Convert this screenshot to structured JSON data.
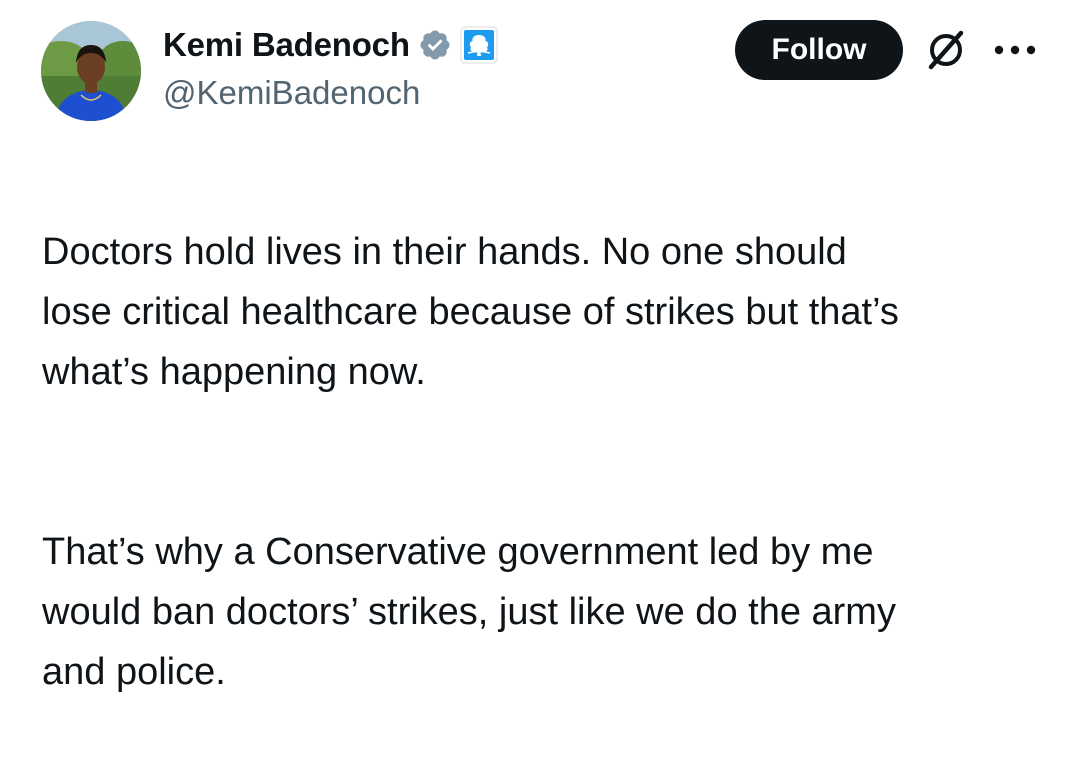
{
  "author": {
    "display_name": "Kemi Badenoch",
    "handle": "@KemiBadenoch",
    "verified_icon": "verified-badge-icon",
    "affiliate_icon": "conservative-party-tree-icon",
    "verified_color": "#829aab",
    "affiliate_color": "#1d9bf0"
  },
  "actions": {
    "follow_label": "Follow",
    "grok_icon": "grok-icon",
    "more_icon": "more-options-icon"
  },
  "tweet": {
    "paragraphs": [
      "Doctors hold lives in their hands. No one should\nlose critical healthcare because of strikes but that’s\nwhat’s happening now.",
      "That’s why a Conservative government led by me\nwould ban doctors’ strikes, just like we do the army\nand police."
    ]
  },
  "colors": {
    "text": "#0f1419",
    "secondary_text": "#536471",
    "follow_bg": "#0f1419",
    "follow_text": "#ffffff"
  }
}
